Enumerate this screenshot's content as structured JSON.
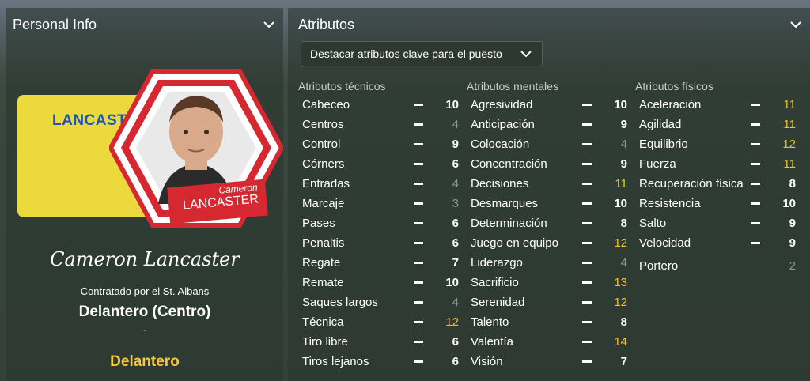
{
  "left_panel": {
    "title": "Personal Info",
    "card_name": "LANCAST",
    "badge_first": "Cameron",
    "badge_last": "LANCASTER",
    "signature": "Cameron Lancaster",
    "contract": "Contratado por el St. Albans",
    "position": "Delantero (Centro)",
    "separator": "-",
    "role": "Delantero"
  },
  "right_panel": {
    "title": "Atributos",
    "dropdown_label": "Destacar atributos clave para el puesto"
  },
  "columns": [
    {
      "header": "Atributos técnicos",
      "rows": [
        {
          "name": "Cabeceo",
          "value": "10",
          "style": "white"
        },
        {
          "name": "Centros",
          "value": "4",
          "style": "grey"
        },
        {
          "name": "Control",
          "value": "9",
          "style": "white"
        },
        {
          "name": "Córners",
          "value": "6",
          "style": "white"
        },
        {
          "name": "Entradas",
          "value": "4",
          "style": "grey"
        },
        {
          "name": "Marcaje",
          "value": "3",
          "style": "grey"
        },
        {
          "name": "Pases",
          "value": "6",
          "style": "white"
        },
        {
          "name": "Penaltis",
          "value": "6",
          "style": "white"
        },
        {
          "name": "Regate",
          "value": "7",
          "style": "white"
        },
        {
          "name": "Remate",
          "value": "10",
          "style": "white"
        },
        {
          "name": "Saques largos",
          "value": "4",
          "style": "grey"
        },
        {
          "name": "Técnica",
          "value": "12",
          "style": "gold"
        },
        {
          "name": "Tiro libre",
          "value": "6",
          "style": "white"
        },
        {
          "name": "Tiros lejanos",
          "value": "6",
          "style": "white"
        }
      ]
    },
    {
      "header": "Atributos mentales",
      "rows": [
        {
          "name": "Agresividad",
          "value": "10",
          "style": "white"
        },
        {
          "name": "Anticipación",
          "value": "9",
          "style": "white"
        },
        {
          "name": "Colocación",
          "value": "4",
          "style": "grey"
        },
        {
          "name": "Concentración",
          "value": "9",
          "style": "white"
        },
        {
          "name": "Decisiones",
          "value": "11",
          "style": "gold"
        },
        {
          "name": "Desmarques",
          "value": "10",
          "style": "white"
        },
        {
          "name": "Determinación",
          "value": "8",
          "style": "white"
        },
        {
          "name": "Juego en equipo",
          "value": "12",
          "style": "gold"
        },
        {
          "name": "Liderazgo",
          "value": "4",
          "style": "grey"
        },
        {
          "name": "Sacrificio",
          "value": "13",
          "style": "gold"
        },
        {
          "name": "Serenidad",
          "value": "12",
          "style": "gold"
        },
        {
          "name": "Talento",
          "value": "8",
          "style": "white"
        },
        {
          "name": "Valentía",
          "value": "14",
          "style": "gold"
        },
        {
          "name": "Visión",
          "value": "7",
          "style": "white"
        }
      ]
    },
    {
      "header": "Atributos físicos",
      "rows": [
        {
          "name": "Aceleración",
          "value": "11",
          "style": "gold"
        },
        {
          "name": "Agilidad",
          "value": "11",
          "style": "gold"
        },
        {
          "name": "Equilibrio",
          "value": "12",
          "style": "gold"
        },
        {
          "name": "Fuerza",
          "value": "11",
          "style": "gold"
        },
        {
          "name": "Recuperación física",
          "value": "8",
          "style": "white"
        },
        {
          "name": "Resistencia",
          "value": "10",
          "style": "white"
        },
        {
          "name": "Salto",
          "value": "9",
          "style": "white"
        },
        {
          "name": "Velocidad",
          "value": "9",
          "style": "white"
        }
      ],
      "extra_row": {
        "name": "Portero",
        "value": "2",
        "style": "grey"
      }
    }
  ],
  "colors": {
    "gold": "#f1c22b",
    "card_yellow": "#ecd93e",
    "badge_red": "#d52831",
    "card_text_blue": "#1c56b8"
  },
  "icons": {
    "collapse": "chevron-down-icon",
    "dropdown": "chevron-down-icon",
    "player_photo": "player-portrait-icon"
  }
}
